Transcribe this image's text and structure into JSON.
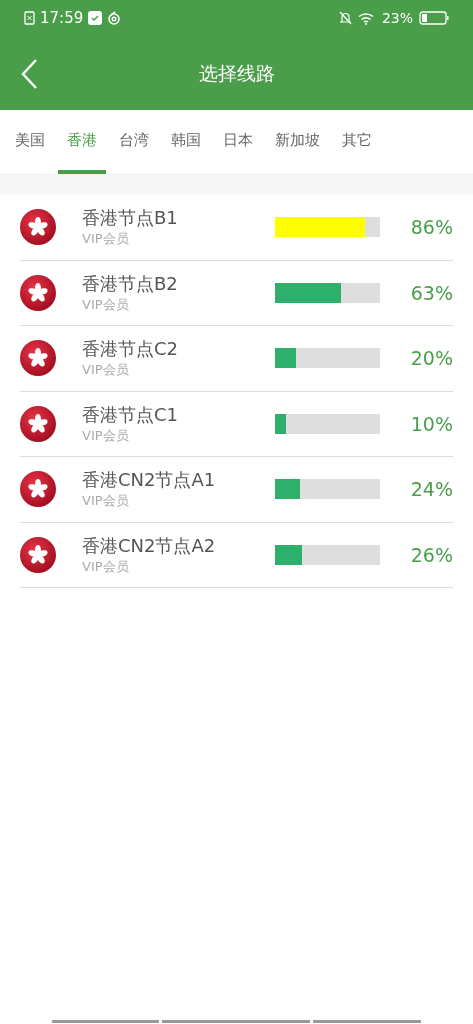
{
  "status_bar": {
    "time": "17:59",
    "battery": "23%"
  },
  "header": {
    "title": "选择线路"
  },
  "tabs": [
    {
      "label": "美国",
      "selected": false
    },
    {
      "label": "香港",
      "selected": true
    },
    {
      "label": "台湾",
      "selected": false
    },
    {
      "label": "韩国",
      "selected": false
    },
    {
      "label": "日本",
      "selected": false
    },
    {
      "label": "新加坡",
      "selected": false
    },
    {
      "label": "其它",
      "selected": false
    }
  ],
  "servers": [
    {
      "name": "香港节点B1",
      "tier": "VIP会员",
      "level": 0.86,
      "color": "#ffff00",
      "reading": "86%"
    },
    {
      "name": "香港节点B2",
      "tier": "VIP会员",
      "level": 0.63,
      "color": "#2eaf6c",
      "reading": "63%"
    },
    {
      "name": "香港节点C2",
      "tier": "VIP会员",
      "level": 0.2,
      "color": "#2eaf6c",
      "reading": "20%"
    },
    {
      "name": "香港节点C1",
      "tier": "VIP会员",
      "level": 0.1,
      "color": "#2eaf6c",
      "reading": "10%"
    },
    {
      "name": "香港CN2节点A1",
      "tier": "VIP会员",
      "level": 0.24,
      "color": "#2eaf6c",
      "reading": "24%"
    },
    {
      "name": "香港CN2节点A2",
      "tier": "VIP会员",
      "level": 0.26,
      "color": "#2eaf6c",
      "reading": "26%"
    }
  ]
}
